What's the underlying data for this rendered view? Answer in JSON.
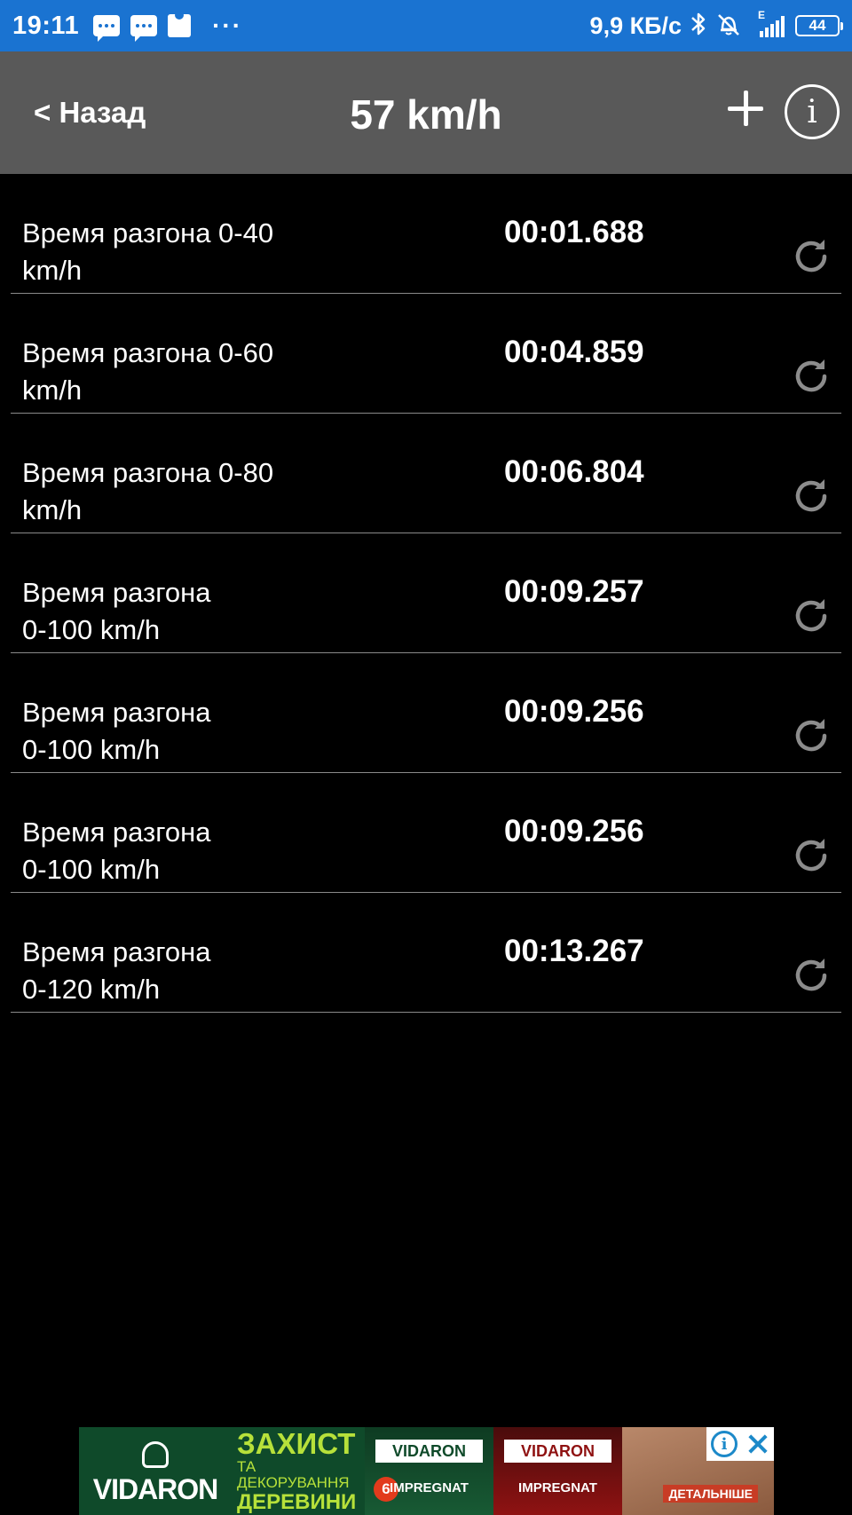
{
  "status_bar": {
    "time": "19:11",
    "more": "···",
    "network_speed": "9,9 КБ/с",
    "network_type": "E",
    "battery": "44",
    "icons": [
      "chat-notification-icon",
      "chat-notification-icon",
      "puzzle-notification-icon",
      "bluetooth-icon",
      "alarm-off-icon",
      "signal-icon",
      "battery-icon"
    ]
  },
  "nav": {
    "back_label": "< Назад",
    "title": "57 km/h",
    "add_icon": "plus-icon",
    "info_icon": "info-icon",
    "info_glyph": "i"
  },
  "results": [
    {
      "label": "Время разгона  0-40\nkm/h",
      "time": "00:01.688"
    },
    {
      "label": "Время разгона  0-60\nkm/h",
      "time": "00:04.859"
    },
    {
      "label": "Время разгона  0-80\nkm/h",
      "time": "00:06.804"
    },
    {
      "label": "Время разгона\n0-100 km/h",
      "time": "00:09.257"
    },
    {
      "label": "Время разгона\n0-100 km/h",
      "time": "00:09.256"
    },
    {
      "label": "Время разгона\n0-100 km/h",
      "time": "00:09.256"
    },
    {
      "label": "Время разгона\n0-120 km/h",
      "time": "00:13.267"
    }
  ],
  "ad": {
    "brand": "VIDARON",
    "headline": "ЗАХИСТ",
    "sub_line": "ТА ДЕКОРУВАННЯ",
    "sub_line2": "ДЕРЕВИНИ",
    "product_label": "VIDARON",
    "product_name": "IMPREGNAT",
    "badge": "6",
    "cta": "ДЕТАЛЬНІШЕ",
    "info_glyph": "i"
  },
  "colors": {
    "status_bar": "#1a73d1",
    "nav_bar": "#595959",
    "background": "#000000",
    "divider": "#8a8a8a",
    "reset_icon": "#8c8c8c"
  }
}
